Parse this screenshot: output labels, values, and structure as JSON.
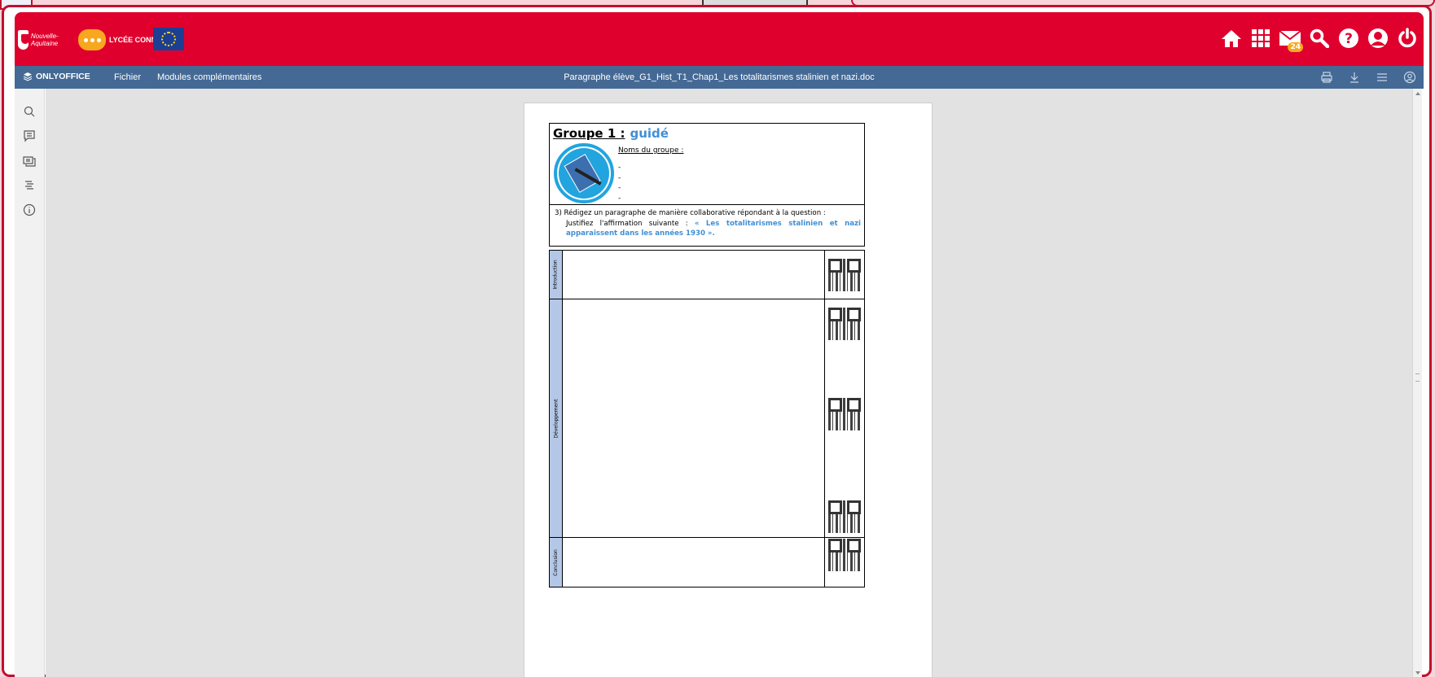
{
  "ent_header": {
    "region_logo": "Nouvelle-Aquitaine",
    "lycee_logo": "LYCÉE CONNECTÉ",
    "eu_logo": "european-union-flag",
    "icons": [
      "home-icon",
      "apps-grid-icon",
      "mail-icon",
      "search-icon",
      "help-icon",
      "user-icon",
      "power-icon"
    ],
    "mail_badge": "24",
    "bar_color": "#e0002d"
  },
  "editor_bar": {
    "brand": "ONLYOFFICE",
    "menu": [
      "Fichier",
      "Modules complémentaires"
    ],
    "document_title": "Paragraphe élève_G1_Hist_T1_Chap1_Les totalitarismes stalinien et nazi.doc",
    "right_icons": [
      "print-icon",
      "download-icon",
      "menu-icon",
      "account-icon"
    ],
    "bar_color": "#446995"
  },
  "left_panel": {
    "icons": [
      "search-icon",
      "comments-icon",
      "chat-icon",
      "navigation-icon",
      "info-icon"
    ]
  },
  "document": {
    "group_label": "Groupe 1 :",
    "group_mode": "guidé",
    "names_label": "Noms du groupe :",
    "name_lines": [
      "-",
      "-",
      "-",
      "-"
    ],
    "question_line1": "3)  Rédigez un paragraphe de manière collaborative répondant à la question :",
    "question_line2_prefix": "Justifiez l'affirmation suivante : ",
    "question_quote": "« Les totalitarismes stalinien et nazi apparaissent dans les années 1930 ».",
    "sections": [
      "Introduction",
      "Développement",
      "Conclusion"
    ],
    "accent_color": "#3f8fd6",
    "section_label_color": "#b4c7e7"
  }
}
